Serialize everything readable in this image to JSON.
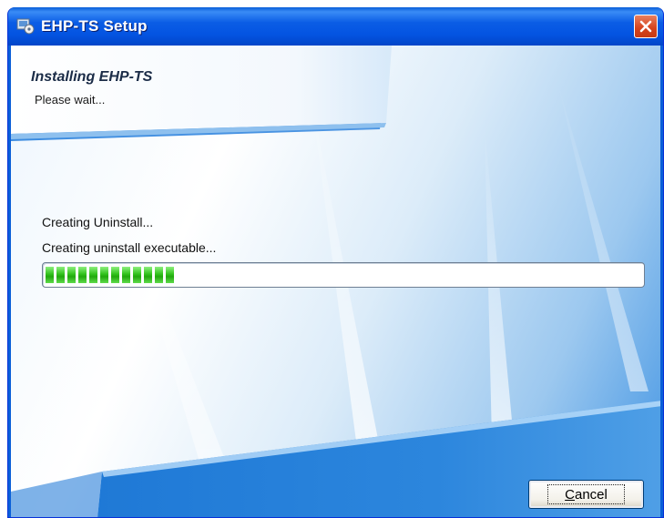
{
  "window": {
    "title": "EHP-TS Setup"
  },
  "header": {
    "title": "Installing EHP-TS",
    "subtitle": "Please wait..."
  },
  "status": {
    "action": "Creating Uninstall...",
    "detail": "Creating uninstall executable..."
  },
  "progress": {
    "segments_filled": 12,
    "fraction": 0.24,
    "color": "#31c21c"
  },
  "buttons": {
    "cancel_label": "Cancel",
    "cancel_mnemonic": "C",
    "cancel_rest": "ancel"
  },
  "icons": {
    "app": "installer-icon",
    "close": "close-icon"
  },
  "colors": {
    "titlebar": "#0454e2",
    "close": "#d5421c",
    "accent": "#3f93e3"
  }
}
